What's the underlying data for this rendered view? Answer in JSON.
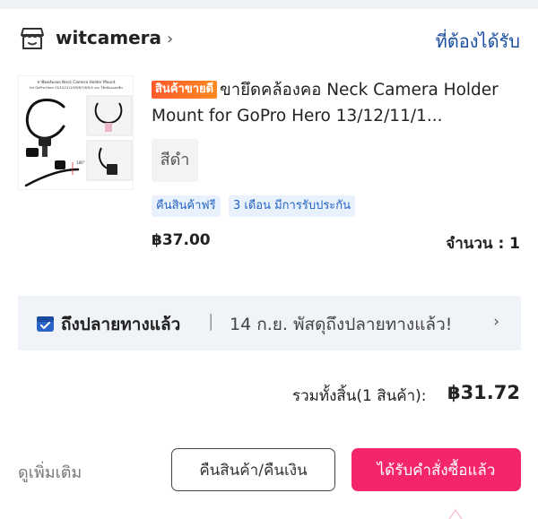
{
  "shop": {
    "name": "witcamera",
    "status": "ที่ต้องได้รับ"
  },
  "product": {
    "thumb_caption_line1": "ขายึดคล้องคอ Neck Camera Holder Mount",
    "thumb_caption_line2": "for GoPro Hero 13/12/11/10/9/8/7/6/5/4 และ ใช้กล้องแอคชั่น",
    "badge": "สินค้าขายดี",
    "title": "ขายึดคล้องคอ Neck Camera Holder Mount for GoPro Hero 13/12/11/1...",
    "variant": "สีดำ",
    "tags": [
      "คืนสินค้าฟรี",
      "3 เดือน มีการรับประกัน"
    ],
    "price": "฿37.00",
    "quantity": "จำนวน : 1"
  },
  "delivery": {
    "label": "ถึงปลายทางแล้ว",
    "separator": "|",
    "detail": "14 ก.ย. พัสดุถึงปลายทางแล้ว!"
  },
  "total": {
    "label": "รวมทั้งสิ้น(1 สินค้า):",
    "amount": "฿31.72"
  },
  "actions": {
    "more": "ดูเพิ่มเติม",
    "refund": "คืนสินค้า/คืนเงิน",
    "received": "ได้รับคำสั่งซื้อแล้ว"
  },
  "colors": {
    "accent": "#f5256b",
    "link": "#1a4fa0",
    "tag_text": "#2563c6",
    "tag_bg": "#e8f1fc",
    "badge": "#ff5a2c",
    "banner_bg": "#f0f3f7"
  },
  "icons": {
    "shop": "store-icon",
    "shop_chevron": "chevron-right-icon",
    "delivery": "package-icon",
    "delivery_chevron": "chevron-right-icon"
  }
}
